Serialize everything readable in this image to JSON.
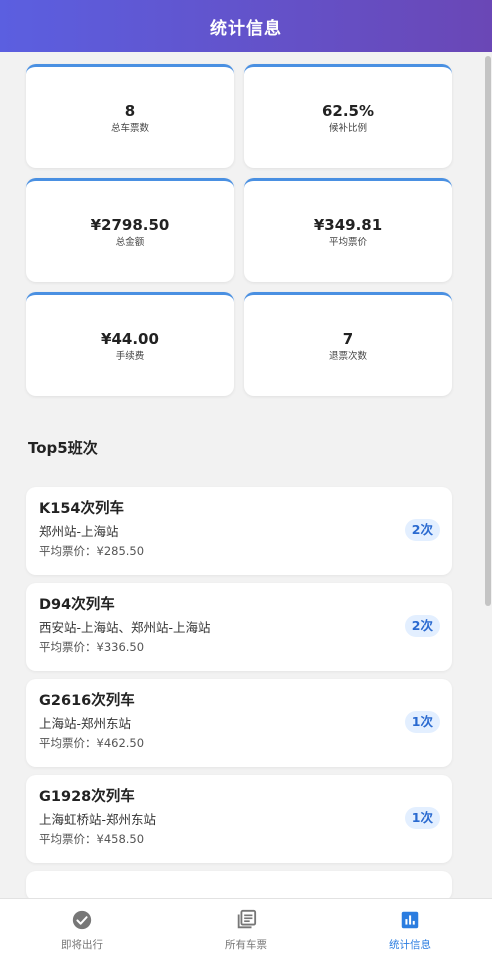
{
  "header": {
    "title": "统计信息"
  },
  "stats": [
    {
      "value": "8",
      "label": "总车票数"
    },
    {
      "value": "62.5%",
      "label": "候补比例"
    },
    {
      "value": "¥2798.50",
      "label": "总金额"
    },
    {
      "value": "¥349.81",
      "label": "平均票价"
    },
    {
      "value": "¥44.00",
      "label": "手续费"
    },
    {
      "value": "7",
      "label": "退票次数"
    }
  ],
  "top5": {
    "title": "Top5班次",
    "items": [
      {
        "name": "K154次列车",
        "route": "郑州站-上海站",
        "price": "平均票价：¥285.50",
        "count": "2次"
      },
      {
        "name": "D94次列车",
        "route": "西安站-上海站、郑州站-上海站",
        "price": "平均票价：¥336.50",
        "count": "2次"
      },
      {
        "name": "G2616次列车",
        "route": "上海站-郑州东站",
        "price": "平均票价：¥462.50",
        "count": "1次"
      },
      {
        "name": "G1928次列车",
        "route": "上海虹桥站-郑州东站",
        "price": "平均票价：¥458.50",
        "count": "1次"
      }
    ]
  },
  "nav": {
    "upcoming": "即将出行",
    "all_tickets": "所有车票",
    "stats": "统计信息"
  },
  "colors": {
    "accent": "#2b7de0",
    "card_top_border": "#4a90e2",
    "header_gradient_start": "#5b5fe0",
    "header_gradient_end": "#6a47b6"
  },
  "icons": {
    "upcoming": "check-circle-icon",
    "all_tickets": "library-books-icon",
    "stats": "bar-chart-icon"
  }
}
